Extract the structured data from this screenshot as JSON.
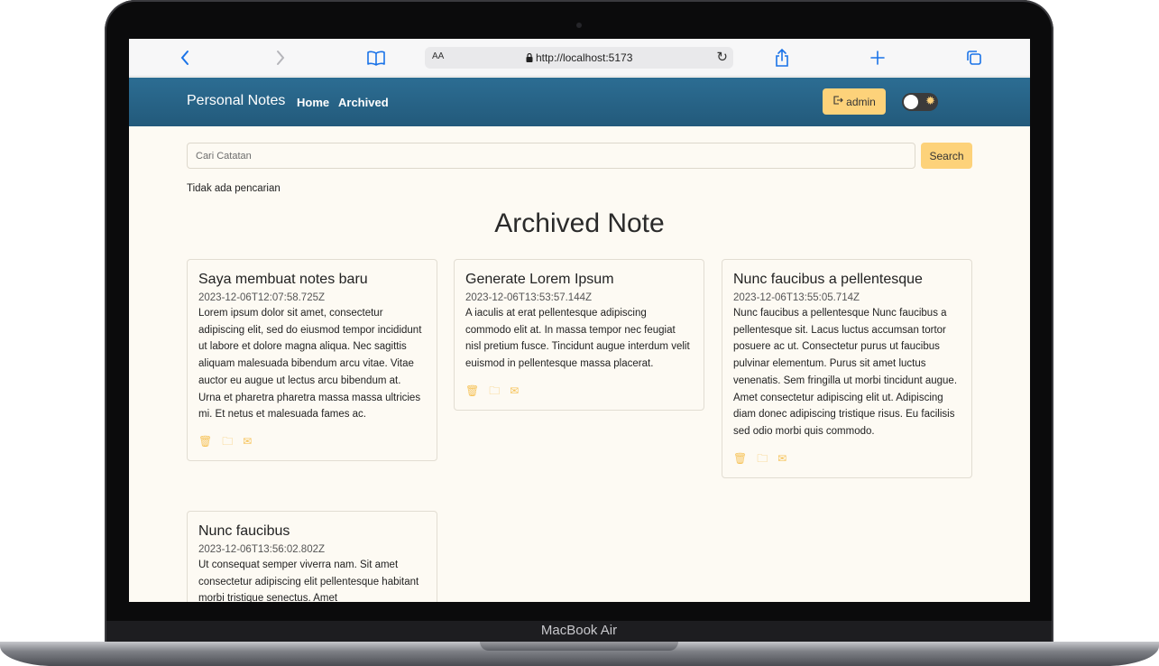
{
  "device": {
    "label": "MacBook Air"
  },
  "browser": {
    "url": "http://localhost:5173",
    "aa": "AA"
  },
  "navbar": {
    "brand": "Personal Notes",
    "links": [
      "Home",
      "Archived"
    ],
    "user_button": "admin"
  },
  "search": {
    "placeholder": "Cari Catatan",
    "button": "Search",
    "status": "Tidak ada pencarian"
  },
  "page": {
    "title": "Archived Note"
  },
  "notes": [
    {
      "title": "Saya membuat notes baru",
      "date": "2023-12-06T12:07:58.725Z",
      "body": "Lorem ipsum dolor sit amet, consectetur adipiscing elit, sed do eiusmod tempor incididunt ut labore et dolore magna aliqua. Nec sagittis aliquam malesuada bibendum arcu vitae. Vitae auctor eu augue ut lectus arcu bibendum at. Urna et pharetra pharetra massa massa ultricies mi. Et netus et malesuada fames ac."
    },
    {
      "title": "Generate Lorem Ipsum",
      "date": "2023-12-06T13:53:57.144Z",
      "body": "A iaculis at erat pellentesque adipiscing commodo elit at. In massa tempor nec feugiat nisl pretium fusce. Tincidunt augue interdum velit euismod in pellentesque massa placerat."
    },
    {
      "title": "Nunc faucibus a pellentesque",
      "date": "2023-12-06T13:55:05.714Z",
      "body": "Nunc faucibus a pellentesque Nunc faucibus a pellentesque sit. Lacus luctus accumsan tortor posuere ac ut. Consectetur purus ut faucibus pulvinar elementum. Purus sit amet luctus venenatis. Sem fringilla ut morbi tincidunt augue. Amet consectetur adipiscing elit ut. Adipiscing diam donec adipiscing tristique risus. Eu facilisis sed odio morbi quis commodo."
    },
    {
      "title": "Nunc faucibus",
      "date": "2023-12-06T13:56:02.802Z",
      "body": "Ut consequat semper viverra nam. Sit amet consectetur adipiscing elit pellentesque habitant morbi tristique senectus. Amet"
    }
  ],
  "icons": {
    "back": "chevron-left-icon",
    "forward": "chevron-right-icon",
    "reader": "book-icon",
    "lock": "lock-icon",
    "reload": "reload-icon",
    "share": "share-icon",
    "new_tab": "plus-icon",
    "tabs": "tabs-icon",
    "logout": "logout-icon",
    "theme": "sun-icon",
    "delete": "trash-icon",
    "archive": "folder-icon",
    "unarchive": "envelope-icon"
  },
  "colors": {
    "navbar": "#2c6d93",
    "accent": "#fdd27a",
    "background": "#fdfaf3",
    "icon": "#f6c35a"
  }
}
